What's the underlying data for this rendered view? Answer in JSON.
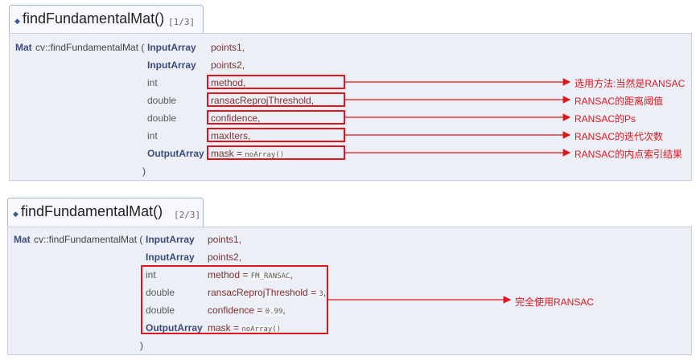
{
  "top": {
    "function_name": "findFundamentalMat()",
    "overload": "[1/3]",
    "return_type": "Mat",
    "signature_prefix": "cv::findFundamentalMat (",
    "params": [
      {
        "type": "InputArray",
        "name": "points1,"
      },
      {
        "type": "InputArray",
        "name": "points2,"
      },
      {
        "type": "int",
        "name": "method,"
      },
      {
        "type": "double",
        "name": "ransacReprojThreshold,"
      },
      {
        "type": "double",
        "name": "confidence,"
      },
      {
        "type": "int",
        "name": "maxIters,"
      },
      {
        "type": "OutputArray",
        "name": "mask = ",
        "default": "noArray()"
      }
    ],
    "close_paren": ")",
    "annotations": [
      "选用方法:当然是RANSAC",
      "RANSAC的距离阈值",
      "RANSAC的Ps",
      "RANSAC的迭代次数",
      "RANSAC的内点索引结果"
    ]
  },
  "bottom": {
    "function_name": "findFundamentalMat()",
    "overload": "[2/3]",
    "return_type": "Mat",
    "signature_prefix": "cv::findFundamentalMat (",
    "params": [
      {
        "type": "InputArray",
        "name": "points1,"
      },
      {
        "type": "InputArray",
        "name": "points2,"
      },
      {
        "type": "int",
        "name": "method = ",
        "default": "FM_RANSAC",
        "suffix": ","
      },
      {
        "type": "double",
        "name": "ransacReprojThreshold = ",
        "default": "3",
        "suffix": ","
      },
      {
        "type": "double",
        "name": "confidence = ",
        "default": "0.99",
        "suffix": ","
      },
      {
        "type": "OutputArray",
        "name": "mask = ",
        "default": "noArray()",
        "suffix": ""
      }
    ],
    "close_paren": ")",
    "annotation": "完全使用RANSAC"
  },
  "colors": {
    "annotation_red": "#e0161e",
    "panel_bg": "#eceff6",
    "type_blue": "#3c4c7a",
    "param_name": "#803030"
  }
}
